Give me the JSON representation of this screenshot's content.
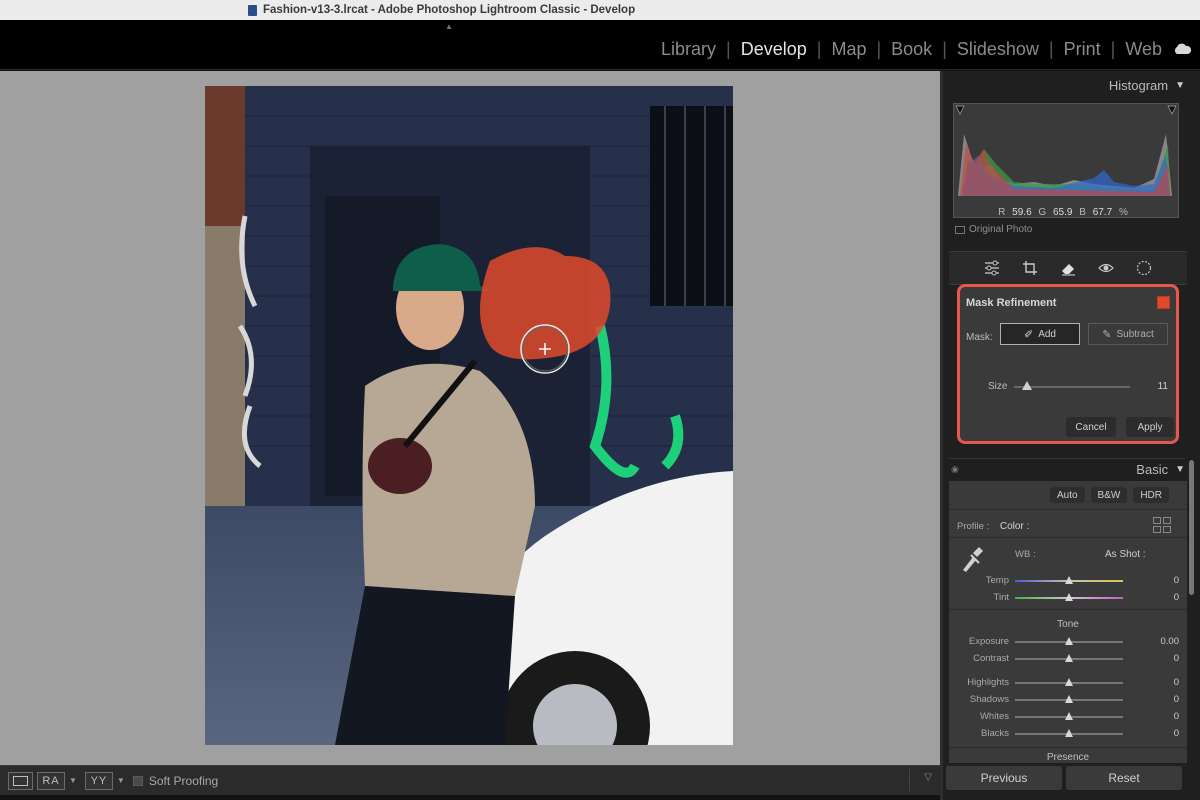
{
  "window": {
    "title": "Fashion-v13-3.lrcat - Adobe Photoshop Lightroom Classic - Develop"
  },
  "modules": [
    {
      "label": "Library",
      "active": false
    },
    {
      "label": "Develop",
      "active": true
    },
    {
      "label": "Map",
      "active": false
    },
    {
      "label": "Book",
      "active": false
    },
    {
      "label": "Slideshow",
      "active": false
    },
    {
      "label": "Print",
      "active": false
    },
    {
      "label": "Web",
      "active": false
    }
  ],
  "histogram": {
    "title": "Histogram",
    "r_label": "R",
    "r_value": "59.6",
    "g_label": "G",
    "g_value": "65.9",
    "b_label": "B",
    "b_value": "67.7",
    "unit": "%",
    "original_photo": "Original Photo"
  },
  "tools": [
    "edit-sliders-icon",
    "crop-icon",
    "eraser-icon",
    "red-eye-icon",
    "masking-icon"
  ],
  "mask_refinement": {
    "title": "Mask Refinement",
    "mask_label": "Mask:",
    "add_label": "Add",
    "subtract_label": "Subtract",
    "size_label": "Size",
    "size_value": "11",
    "size_fraction": 0.11,
    "cancel_label": "Cancel",
    "apply_label": "Apply",
    "overlay_color": "#e04a2b"
  },
  "basic": {
    "title": "Basic",
    "auto_label": "Auto",
    "bw_label": "B&W",
    "hdr_label": "HDR",
    "profile_label": "Profile :",
    "profile_value": "Color :",
    "wb_label": "WB :",
    "wb_value": "As Shot :",
    "tone_label": "Tone",
    "presence_label": "Presence",
    "sliders": {
      "temp": {
        "label": "Temp",
        "value": "0"
      },
      "tint": {
        "label": "Tint",
        "value": "0"
      },
      "exposure": {
        "label": "Exposure",
        "value": "0.00"
      },
      "contrast": {
        "label": "Contrast",
        "value": "0"
      },
      "highlights": {
        "label": "Highlights",
        "value": "0"
      },
      "shadows": {
        "label": "Shadows",
        "value": "0"
      },
      "whites": {
        "label": "Whites",
        "value": "0"
      },
      "blacks": {
        "label": "Blacks",
        "value": "0"
      }
    }
  },
  "toolbar": {
    "compare_ra": "RA",
    "compare_yy": "YY",
    "soft_proofing": "Soft Proofing"
  },
  "footer": {
    "previous_label": "Previous",
    "reset_label": "Reset"
  }
}
